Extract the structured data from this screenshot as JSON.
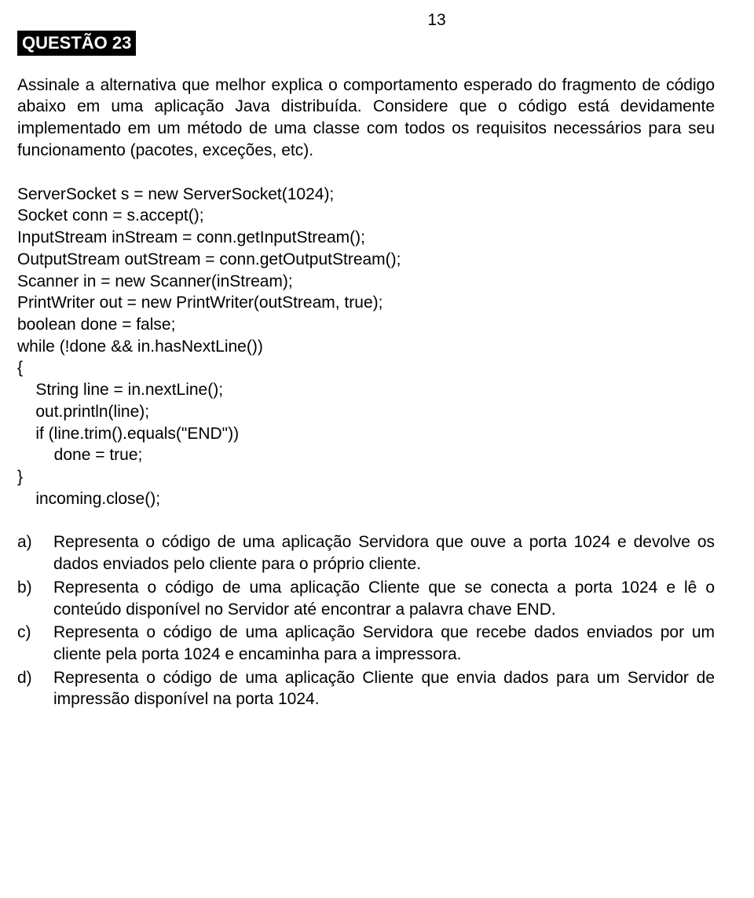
{
  "page_number": "13",
  "question_title": "QUESTÃO 23",
  "intro_paragraph": "Assinale a alternativa que melhor explica o comportamento esperado do fragmento de código abaixo em uma aplicação Java distribuída. Considere que o código está devidamente implementado em um método de uma classe com todos os requisitos necessários para seu funcionamento (pacotes, exceções, etc).",
  "code": "ServerSocket s = new ServerSocket(1024);\nSocket conn = s.accept();\nInputStream inStream = conn.getInputStream();\nOutputStream outStream = conn.getOutputStream();\nScanner in = new Scanner(inStream);\nPrintWriter out = new PrintWriter(outStream, true);\nboolean done = false;\nwhile (!done && in.hasNextLine())\n{\n    String line = in.nextLine();\n    out.println(line);\n    if (line.trim().equals(\"END\"))\n        done = true;\n}\n    incoming.close();",
  "options": [
    {
      "label": "a)",
      "text": "Representa o código de uma aplicação Servidora que ouve a porta 1024 e devolve os dados enviados pelo cliente para o próprio cliente."
    },
    {
      "label": "b)",
      "text": "Representa o código de uma aplicação Cliente que se conecta a porta 1024 e lê o conteúdo disponível no Servidor até encontrar a palavra chave END."
    },
    {
      "label": "c)",
      "text": "Representa o código de uma aplicação Servidora que recebe dados enviados por um cliente pela porta 1024 e encaminha para a impressora."
    },
    {
      "label": "d)",
      "text": "Representa o código de uma aplicação Cliente que envia dados para um Servidor de impressão disponível na porta 1024."
    }
  ]
}
